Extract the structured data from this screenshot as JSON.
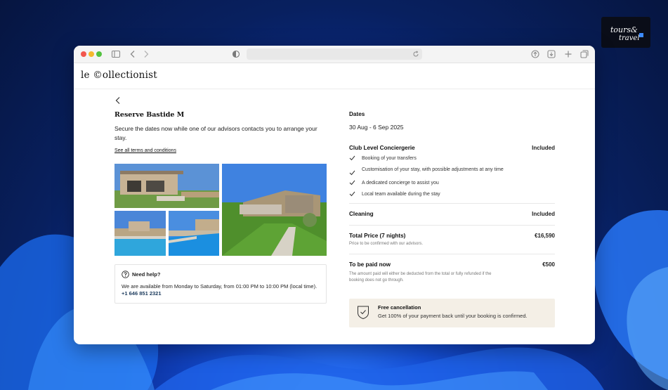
{
  "site": {
    "brand": "le ©ollectionist"
  },
  "colors": {
    "accent_phone": "#1b3a5c",
    "cancel_bg": "#f4efe6"
  },
  "left": {
    "title": "Reserve Bastide M",
    "subtitle": "Secure the dates now while one of our advisors contacts you to arrange your stay.",
    "terms_link": "See all terms and conditions",
    "gallery": [
      "photo-villa-terrace",
      "photo-villa-garden",
      "photo-pool-1",
      "photo-pool-2"
    ]
  },
  "help": {
    "title": "Need help?",
    "text": "We are available from Monday to Saturday, from 01:00 PM to 10:00 PM (local time).",
    "phone": "+1 646 851 2321"
  },
  "booking": {
    "dates_label": "Dates",
    "dates_value": "30 Aug - 6 Sep 2025",
    "concierge_label": "Club Level Conciergerie",
    "concierge_value": "Included",
    "concierge_items": [
      "Booking of your transfers",
      "Customisation of your stay, with possible adjustments at any time",
      "A dedicated concierge to assist you",
      "Local team available during the stay"
    ],
    "cleaning_label": "Cleaning",
    "cleaning_value": "Included",
    "total_label": "Total Price (7 nights)",
    "total_value": "€16,590",
    "total_note": "Price to be confirmed with our advisors.",
    "pay_label": "To be paid now",
    "pay_value": "€500",
    "pay_note": "The amount paid will either be deducted from the total or fully refunded if the booking does not go through."
  },
  "cancellation": {
    "title": "Free cancellation",
    "text": "Get 100% of your payment back until your booking is confirmed."
  }
}
